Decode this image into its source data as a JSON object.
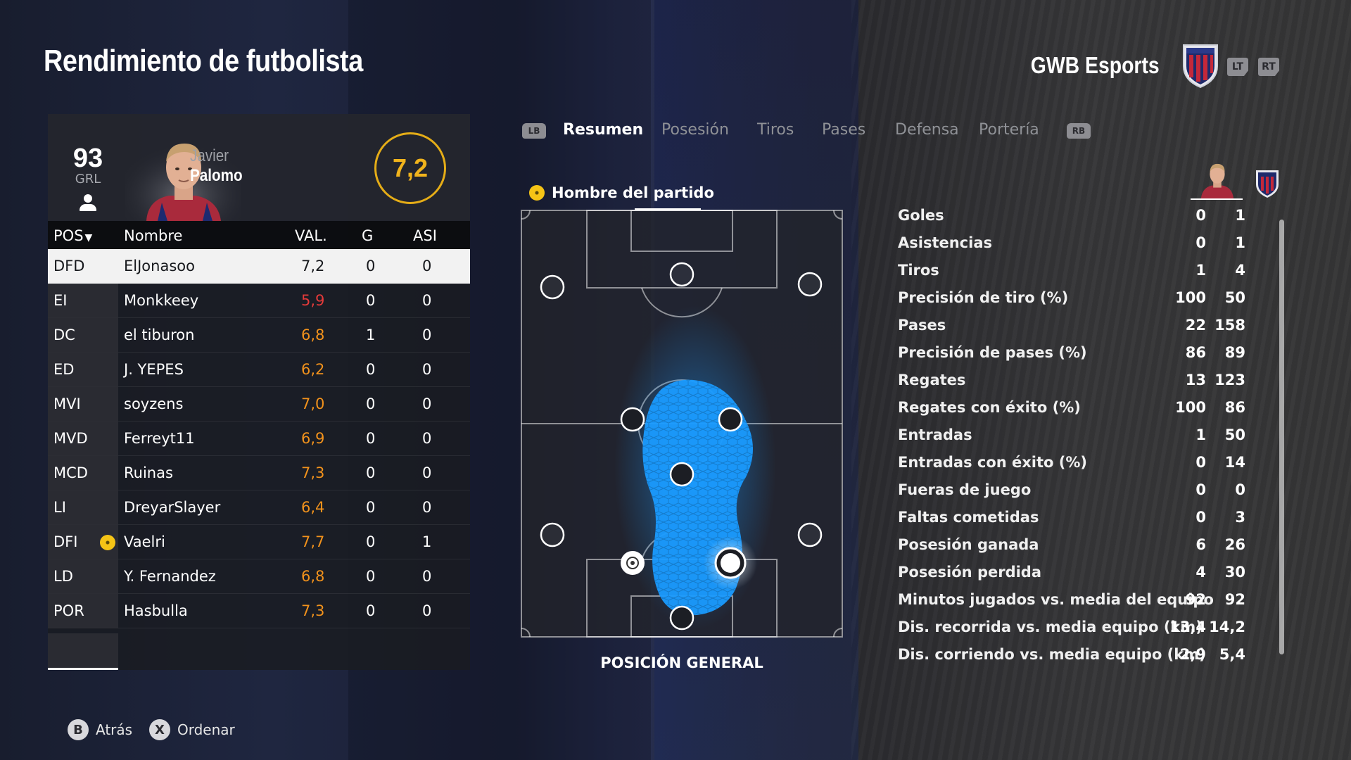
{
  "header": {
    "title": "Rendimiento de futbolista",
    "team_name": "GWB Esports",
    "trigger_left": "LT",
    "trigger_right": "RT"
  },
  "player": {
    "overall": "93",
    "overall_label": "GRL",
    "first_name": "Javier",
    "last_name": "Palomo",
    "rating": "7,2"
  },
  "table": {
    "headers": {
      "pos": "POS",
      "name": "Nombre",
      "val": "VAL.",
      "g": "G",
      "asi": "ASI"
    },
    "rows": [
      {
        "pos": "DFD",
        "name": "ElJonasoo",
        "val": "7,2",
        "val_color": "plain",
        "g": "0",
        "asi": "0",
        "selected": true,
        "motm": false
      },
      {
        "pos": "EI",
        "name": "Monkkeey",
        "val": "5,9",
        "val_color": "red",
        "g": "0",
        "asi": "0",
        "selected": false,
        "motm": false
      },
      {
        "pos": "DC",
        "name": "el tiburon",
        "val": "6,8",
        "val_color": "orange",
        "g": "1",
        "asi": "0",
        "selected": false,
        "motm": false
      },
      {
        "pos": "ED",
        "name": "J. YEPES",
        "val": "6,2",
        "val_color": "orange",
        "g": "0",
        "asi": "0",
        "selected": false,
        "motm": false
      },
      {
        "pos": "MVI",
        "name": "soyzens",
        "val": "7,0",
        "val_color": "orange",
        "g": "0",
        "asi": "0",
        "selected": false,
        "motm": false
      },
      {
        "pos": "MVD",
        "name": "Ferreyt11",
        "val": "6,9",
        "val_color": "orange",
        "g": "0",
        "asi": "0",
        "selected": false,
        "motm": false
      },
      {
        "pos": "MCD",
        "name": "Ruinas",
        "val": "7,3",
        "val_color": "orange",
        "g": "0",
        "asi": "0",
        "selected": false,
        "motm": false
      },
      {
        "pos": "LI",
        "name": "DreyarSlayer",
        "val": "6,4",
        "val_color": "orange",
        "g": "0",
        "asi": "0",
        "selected": false,
        "motm": false
      },
      {
        "pos": "DFI",
        "name": "Vaelri",
        "val": "7,7",
        "val_color": "orange",
        "g": "0",
        "asi": "1",
        "selected": false,
        "motm": true
      },
      {
        "pos": "LD",
        "name": "Y. Fernandez",
        "val": "6,8",
        "val_color": "orange",
        "g": "0",
        "asi": "0",
        "selected": false,
        "motm": false
      },
      {
        "pos": "POR",
        "name": "Hasbulla",
        "val": "7,3",
        "val_color": "orange",
        "g": "0",
        "asi": "0",
        "selected": false,
        "motm": false
      }
    ]
  },
  "tabs": {
    "left_bumper": "LB",
    "right_bumper": "RB",
    "items": [
      "Resumen",
      "Posesión",
      "Tiros",
      "Pases",
      "Defensa",
      "Portería"
    ],
    "active_index": 0
  },
  "pitch": {
    "motm_label": "Hombre del partido",
    "title": "POSICIÓN GENERAL"
  },
  "stats": [
    {
      "label": "Goles",
      "player": "0",
      "team": "1"
    },
    {
      "label": "Asistencias",
      "player": "0",
      "team": "1"
    },
    {
      "label": "Tiros",
      "player": "1",
      "team": "4"
    },
    {
      "label": "Precisión de tiro (%)",
      "player": "100",
      "team": "50"
    },
    {
      "label": "Pases",
      "player": "22",
      "team": "158"
    },
    {
      "label": "Precisión de pases (%)",
      "player": "86",
      "team": "89"
    },
    {
      "label": "Regates",
      "player": "13",
      "team": "123"
    },
    {
      "label": "Regates con éxito (%)",
      "player": "100",
      "team": "86"
    },
    {
      "label": "Entradas",
      "player": "1",
      "team": "50"
    },
    {
      "label": "Entradas con éxito (%)",
      "player": "0",
      "team": "14"
    },
    {
      "label": "Fueras de juego",
      "player": "0",
      "team": "0"
    },
    {
      "label": "Faltas cometidas",
      "player": "0",
      "team": "3"
    },
    {
      "label": "Posesión ganada",
      "player": "6",
      "team": "26"
    },
    {
      "label": "Posesión perdida",
      "player": "4",
      "team": "30"
    },
    {
      "label": "Minutos jugados vs. media del equipo",
      "player": "92",
      "team": "92"
    },
    {
      "label": "Dis. recorrida vs. media equipo (km)",
      "player": "13,4",
      "team": "14,2"
    },
    {
      "label": "Dis. corriendo vs. media equipo (km)",
      "player": "2,9",
      "team": "5,4"
    }
  ],
  "footer": {
    "back_key": "B",
    "back_label": "Atrás",
    "sort_key": "X",
    "sort_label": "Ordenar"
  },
  "colors": {
    "accent_gold": "#f0b31c",
    "rating_orange": "#f2921c",
    "rating_red": "#e43a3a",
    "heatmap_blue": "#1a9bff"
  }
}
